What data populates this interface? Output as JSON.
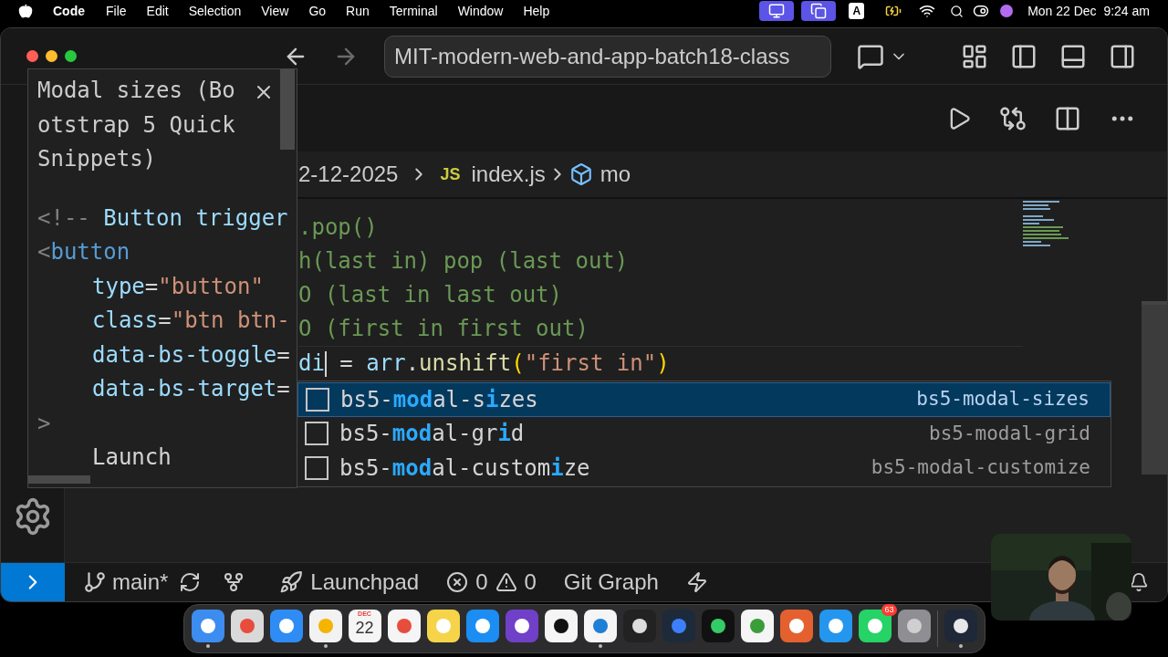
{
  "menubar": {
    "app": "Code",
    "menus": [
      "File",
      "Edit",
      "Selection",
      "View",
      "Go",
      "Run",
      "Terminal",
      "Window",
      "Help"
    ],
    "input_source": "A",
    "clock": "Mon 22 Dec  9:24 am"
  },
  "window": {
    "title": "MIT-modern-web-and-app-batch18-class"
  },
  "breadcrumb": {
    "folder": "2-12-2025",
    "file_badge": "JS",
    "file": "index.js",
    "symbol": "mo"
  },
  "code_lines": [
    {
      "tokens": [
        {
          "kind": "comment",
          "text": ".pop()"
        }
      ]
    },
    {
      "tokens": [
        {
          "kind": "comment",
          "text": "h(last in) pop (last out)"
        }
      ]
    },
    {
      "tokens": [
        {
          "kind": "comment",
          "text": "O (last in last out)"
        }
      ]
    },
    {
      "tokens": [
        {
          "kind": "comment",
          "text": "O (first in first out)"
        }
      ]
    },
    {
      "tokens": [
        {
          "kind": "variable",
          "text": "di",
          "cursor_after": true
        },
        {
          "kind": "punct",
          "text": " = "
        },
        {
          "kind": "variable",
          "text": "arr"
        },
        {
          "kind": "punct",
          "text": "."
        },
        {
          "kind": "func",
          "text": "unshift"
        },
        {
          "kind": "bracket",
          "text": "("
        },
        {
          "kind": "string",
          "text": "\"first in\""
        },
        {
          "kind": "bracket",
          "text": ")"
        }
      ]
    }
  ],
  "hover_doc": {
    "title": "Modal sizes (Bootstrap 5 Quick Snippets)",
    "lines": [
      {
        "indent": false,
        "tokens": [
          {
            "kind": "tagpunct",
            "text": "<!-- "
          },
          {
            "kind": "attr",
            "text": "Button trigger"
          }
        ]
      },
      {
        "indent": false,
        "tokens": [
          {
            "kind": "tagpunct",
            "text": "<"
          },
          {
            "kind": "tag",
            "text": "button"
          }
        ]
      },
      {
        "indent": true,
        "tokens": [
          {
            "kind": "attr",
            "text": "type"
          },
          {
            "kind": "punct",
            "text": "="
          },
          {
            "kind": "string",
            "text": "\"button\""
          }
        ]
      },
      {
        "indent": true,
        "tokens": [
          {
            "kind": "attr",
            "text": "class"
          },
          {
            "kind": "punct",
            "text": "="
          },
          {
            "kind": "string",
            "text": "\"btn btn-"
          }
        ]
      },
      {
        "indent": true,
        "tokens": [
          {
            "kind": "attr",
            "text": "data-bs-toggle"
          },
          {
            "kind": "punct",
            "text": "="
          }
        ]
      },
      {
        "indent": true,
        "tokens": [
          {
            "kind": "attr",
            "text": "data-bs-target"
          },
          {
            "kind": "punct",
            "text": "="
          }
        ]
      },
      {
        "indent": false,
        "tokens": [
          {
            "kind": "tagpunct",
            "text": ">"
          }
        ]
      },
      {
        "indent": true,
        "tokens": [
          {
            "kind": "text",
            "text": "Launch"
          }
        ]
      }
    ]
  },
  "suggestions": [
    {
      "selected": true,
      "parts": [
        {
          "text": "bs5-",
          "match": false
        },
        {
          "text": "mod",
          "match": true
        },
        {
          "text": "al-s",
          "match": false
        },
        {
          "text": "i",
          "match": true
        },
        {
          "text": "zes",
          "match": false
        }
      ],
      "detail": "bs5-modal-sizes"
    },
    {
      "selected": false,
      "parts": [
        {
          "text": "bs5-",
          "match": false
        },
        {
          "text": "mod",
          "match": true
        },
        {
          "text": "al-gr",
          "match": false
        },
        {
          "text": "i",
          "match": true
        },
        {
          "text": "d",
          "match": false
        }
      ],
      "detail": "bs5-modal-grid"
    },
    {
      "selected": false,
      "parts": [
        {
          "text": "bs5-",
          "match": false
        },
        {
          "text": "mod",
          "match": true
        },
        {
          "text": "al-custom",
          "match": false
        },
        {
          "text": "i",
          "match": true
        },
        {
          "text": "ze",
          "match": false
        }
      ],
      "detail": "bs5-modal-customize"
    }
  ],
  "status_bar": {
    "branch": "main*",
    "launchpad": "Launchpad",
    "errors": "0",
    "warnings": "0",
    "git_graph": "Git Graph"
  },
  "dock": [
    {
      "running": true
    },
    {
      "running": false
    },
    {
      "running": false
    },
    {
      "running": true
    },
    {
      "running": false,
      "month": "DEC",
      "day": "22"
    },
    {
      "running": false
    },
    {
      "running": false
    },
    {
      "running": false
    },
    {
      "running": false
    },
    {
      "running": false
    },
    {
      "running": true
    },
    {
      "running": false
    },
    {
      "running": false
    },
    {
      "running": false
    },
    {
      "running": false
    },
    {
      "running": false
    },
    {
      "running": false
    },
    {
      "running": false,
      "badge": "63"
    },
    {
      "running": false
    },
    {
      "running": true
    }
  ]
}
